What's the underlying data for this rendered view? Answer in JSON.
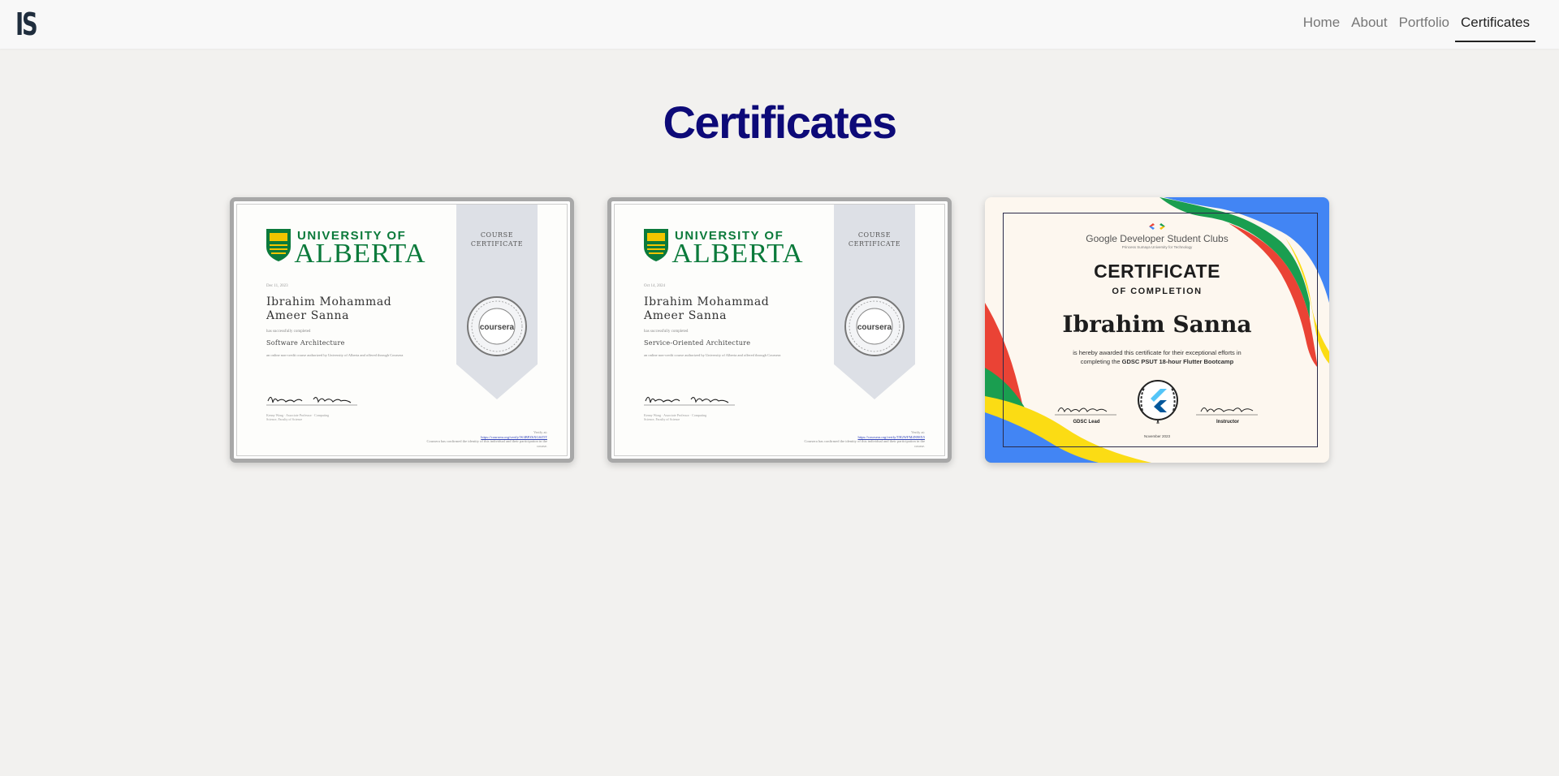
{
  "brand": {
    "logo_text": "IS"
  },
  "nav": {
    "items": [
      {
        "label": "Home",
        "active": false
      },
      {
        "label": "About",
        "active": false
      },
      {
        "label": "Portfolio",
        "active": false
      },
      {
        "label": "Certificates",
        "active": true
      }
    ]
  },
  "page": {
    "title": "Certificates"
  },
  "certificates": [
    {
      "university_top": "UNIVERSITY OF",
      "university_name": "ALBERTA",
      "date": "Dec 11, 2023",
      "name": "Ibrahim Mohammad Ameer Sanna",
      "completed": "has successfully completed",
      "course": "Software Architecture",
      "description": "an online non-credit course authorized by University of Alberta and offered through Coursera",
      "signature": "Kenny Wong",
      "signer_title": "Kenny Wong · Associate Professor · Computing Science, Faculty of Science",
      "ribbon_line1": "COURSE",
      "ribbon_line2": "CERTIFICATE",
      "seal_label": "coursera",
      "verify_label": "Verify at:",
      "verify_link": "https://coursera.org/verify/W4BPZ6XGSZ5T",
      "verify_note": "Coursera has confirmed the identity of this individual and their participation in the course."
    },
    {
      "university_top": "UNIVERSITY OF",
      "university_name": "ALBERTA",
      "date": "Oct 14, 2024",
      "name": "Ibrahim Mohammad Ameer Sanna",
      "completed": "has successfully completed",
      "course": "Service-Oriented Architecture",
      "description": "an online non-credit course authorized by University of Alberta and offered through Coursera",
      "signature": "Kenny Wong",
      "signer_title": "Kenny Wong · Associate Professor · Computing Science, Faculty of Science",
      "ribbon_line1": "COURSE",
      "ribbon_line2": "CERTIFICATE",
      "seal_label": "coursera",
      "verify_label": "Verify at:",
      "verify_link": "https://coursera.org/verify/TH2WFM4N98X5",
      "verify_note": "Coursera has confirmed the identity of this individual and their participation in the course."
    }
  ],
  "gdsc": {
    "org": "Google Developer Student Clubs",
    "org_sub": "Princess Sumaya University for Technology",
    "title": "CERTIFICATE",
    "subtitle": "OF COMPLETION",
    "name": "Ibrahim Sanna",
    "desc_line1": "is hereby awarded this certificate for their exceptional efforts in",
    "desc_prefix": "completing the ",
    "desc_bold": "GDSC PSUT 18-hour Flutter Bootcamp",
    "left_role": "GDSC Lead",
    "right_role": "Instructor",
    "date": "November 2023"
  },
  "colors": {
    "title": "#0d0a78",
    "alberta_green": "#0b7a3b",
    "google_blue": "#4285f4",
    "google_red": "#ea4335",
    "google_yellow": "#fbdc14",
    "google_green": "#1a9e50"
  }
}
